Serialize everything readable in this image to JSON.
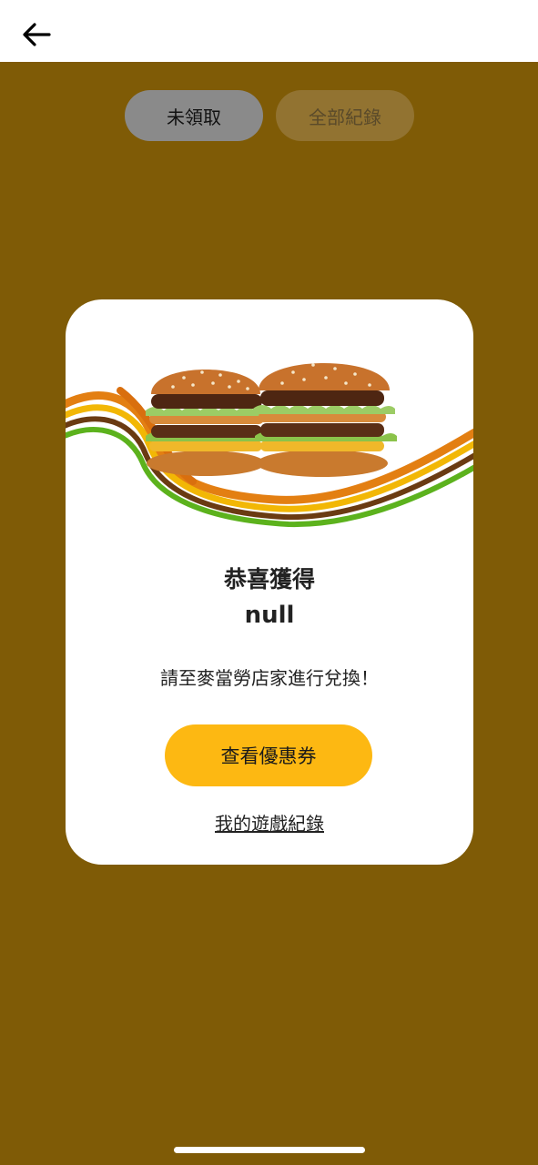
{
  "header": {
    "back_icon": "arrow-left-icon"
  },
  "tabs": [
    {
      "label": "未領取",
      "active": true
    },
    {
      "label": "全部紀錄",
      "active": false
    }
  ],
  "dialog": {
    "image": "big-mac-burgers-ribbon",
    "title": "恭喜獲得",
    "prize": "null",
    "instruction": "請至麥當勞店家進行兌換！",
    "primary_button": "查看優惠券",
    "secondary_link": "我的遊戲紀錄"
  },
  "colors": {
    "background": "#7f5b06",
    "button": "#fdb812",
    "card": "#ffffff"
  }
}
